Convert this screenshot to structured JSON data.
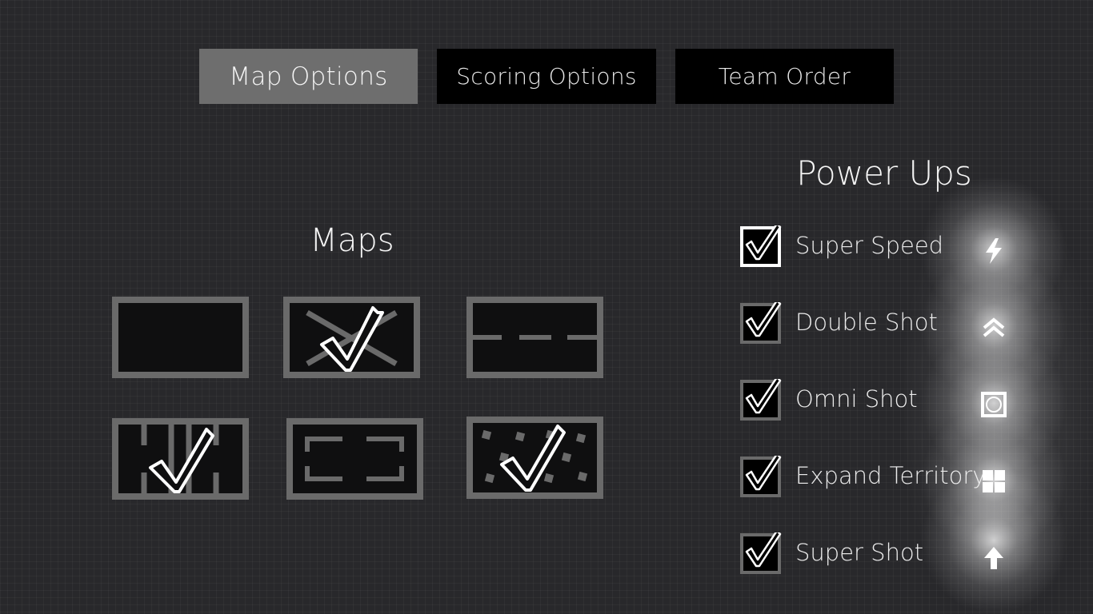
{
  "tabs": [
    {
      "label": "Map Options",
      "active": true
    },
    {
      "label": "Scoring Options",
      "active": false
    },
    {
      "label": "Team Order",
      "active": false
    }
  ],
  "maps": {
    "title": "Maps",
    "items": [
      {
        "layout": "empty",
        "selected": false
      },
      {
        "layout": "cross",
        "selected": true
      },
      {
        "layout": "dashed-line",
        "selected": false
      },
      {
        "layout": "barriers",
        "selected": true
      },
      {
        "layout": "corner-brackets",
        "selected": false
      },
      {
        "layout": "scattered-blocks",
        "selected": true
      }
    ]
  },
  "power_ups": {
    "title": "Power Ups",
    "items": [
      {
        "label": "Super Speed",
        "checked": true,
        "focused": true,
        "icon": "lightning-icon"
      },
      {
        "label": "Double Shot",
        "checked": true,
        "focused": false,
        "icon": "double-chevron-icon"
      },
      {
        "label": "Omni Shot",
        "checked": true,
        "focused": false,
        "icon": "omni-frame-icon"
      },
      {
        "label": "Expand Territory",
        "checked": true,
        "focused": false,
        "icon": "grid-icon"
      },
      {
        "label": "Super Shot",
        "checked": true,
        "focused": false,
        "icon": "up-arrow-icon"
      }
    ]
  },
  "colors": {
    "background": "#28282b",
    "tab_active": "#6e6e6e",
    "tab_inactive": "#000000",
    "tile_border": "#6a6a6a",
    "tile_fill": "#0f0f10",
    "check": "#ffffff"
  }
}
